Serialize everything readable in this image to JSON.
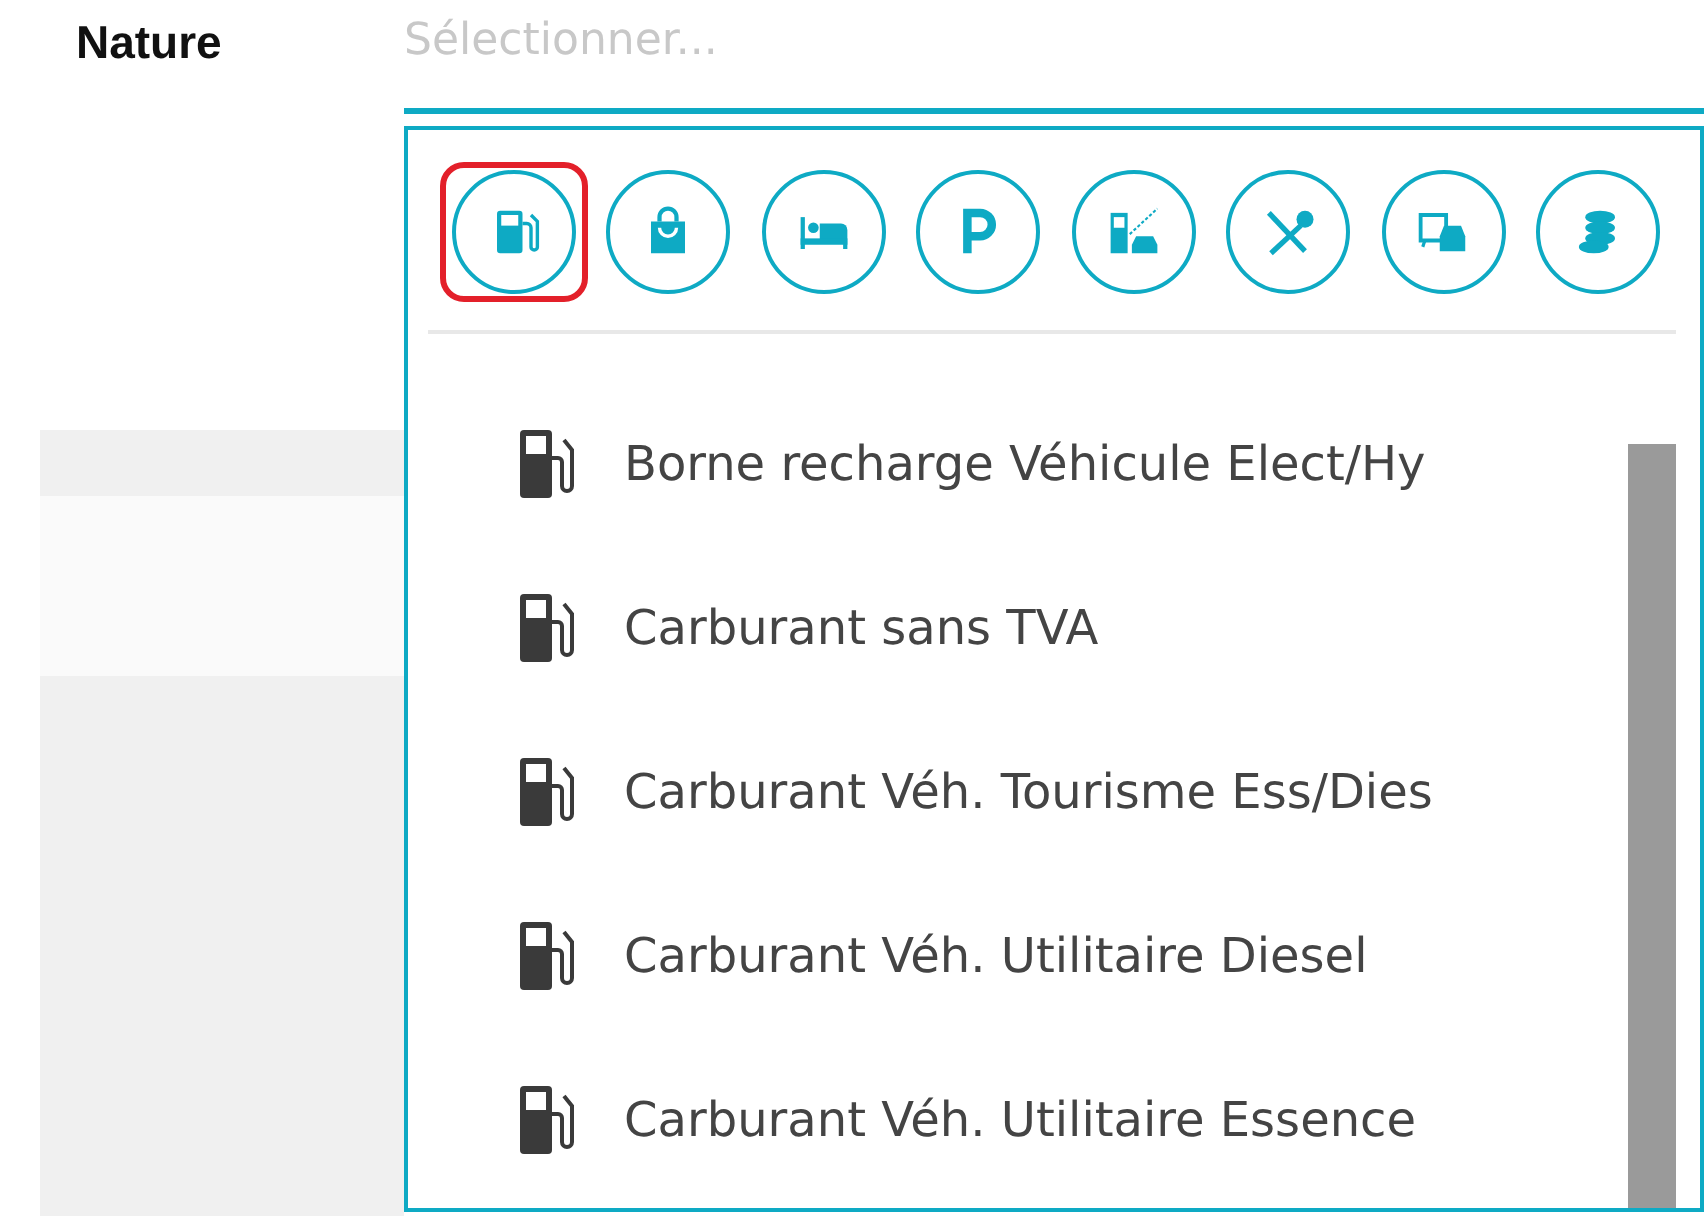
{
  "field": {
    "label": "Nature",
    "placeholder": "Sélectionner..."
  },
  "categories": [
    {
      "kind": "fuel",
      "selected": true
    },
    {
      "kind": "shopping",
      "selected": false
    },
    {
      "kind": "lodging",
      "selected": false
    },
    {
      "kind": "parking",
      "selected": false
    },
    {
      "kind": "toll",
      "selected": false
    },
    {
      "kind": "restaurant",
      "selected": false
    },
    {
      "kind": "transport",
      "selected": false
    },
    {
      "kind": "money",
      "selected": false
    }
  ],
  "options": [
    {
      "label": "Borne recharge Véhicule Elect/Hy"
    },
    {
      "label": "Carburant sans TVA"
    },
    {
      "label": "Carburant Véh. Tourisme Ess/Dies"
    },
    {
      "label": "Carburant Véh. Utilitaire Diesel"
    },
    {
      "label": "Carburant Véh. Utilitaire Essence"
    }
  ]
}
